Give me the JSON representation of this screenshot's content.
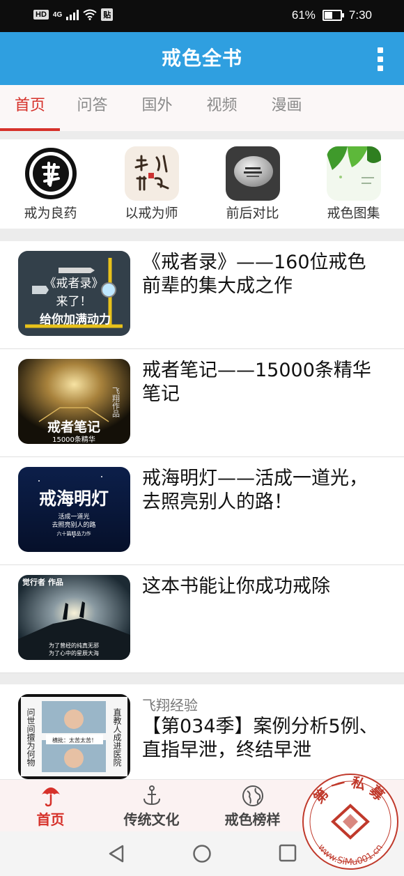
{
  "status": {
    "badge1": "HD",
    "badge2": "贴",
    "net": "4G",
    "battery": "61%",
    "battery_level": 0.61,
    "time": "7:30"
  },
  "header": {
    "title": "戒色全书"
  },
  "tabs": [
    {
      "label": "首页",
      "active": true
    },
    {
      "label": "问答"
    },
    {
      "label": "国外"
    },
    {
      "label": "视频"
    },
    {
      "label": "漫画"
    }
  ],
  "categories": [
    {
      "label": "戒为良药",
      "icon": "jie-calligraphy-icon"
    },
    {
      "label": "以戒为师",
      "icon": "calligraphy-icon"
    },
    {
      "label": "前后对比",
      "icon": "stone-icon"
    },
    {
      "label": "戒色图集",
      "icon": "leaves-icon"
    }
  ],
  "articles": [
    {
      "title": "《戒者录》——160位戒色前辈的集大成之作",
      "thumb_text": [
        "《戒者录》",
        "来了！",
        "给你加满动力"
      ]
    },
    {
      "title": "戒者笔记——15000条精华笔记",
      "thumb_text": [
        "戒者笔记",
        "15000条精华",
        "飞翔作品"
      ]
    },
    {
      "title": "戒海明灯——活成一道光，去照亮别人的路！",
      "thumb_text": [
        "戒海明灯",
        "活成一道光",
        "去照亮别人的路",
        "六十篇精品力作"
      ]
    },
    {
      "title": "这本书能让你成功戒除",
      "thumb_text": [
        "觉行者 作品",
        "为了曾经的纯真无邪",
        "为了心中的星辰大海"
      ]
    },
    {
      "source": "飞翔经验",
      "title": "【第034季】案例分析5例、直指早泄，终结早泄",
      "thumb_text": [
        "问世间擅为何物",
        "直教人成进医院",
        "横批：太苦太苦！"
      ]
    }
  ],
  "bottom_nav": [
    {
      "label": "首页",
      "icon": "umbrella-icon",
      "active": true
    },
    {
      "label": "传统文化",
      "icon": "anchor-icon"
    },
    {
      "label": "戒色榜样",
      "icon": "globe-icon"
    },
    {
      "label": "",
      "icon": "dropbox-icon"
    }
  ],
  "watermark": {
    "top": "第一私募",
    "bottom": "www.SiMu001.cn"
  },
  "colors": {
    "accent": "#d6312a",
    "header": "#2f9fe0"
  }
}
